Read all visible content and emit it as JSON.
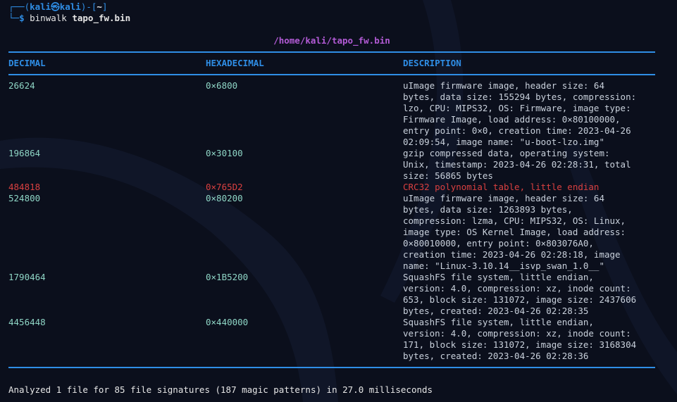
{
  "prompt": {
    "user": "kali",
    "host": "kali",
    "path": "~",
    "command": "binwalk",
    "argument": "tapo_fw.bin"
  },
  "file_title": "/home/kali/tapo_fw.bin",
  "headers": {
    "decimal": "DECIMAL",
    "hexadecimal": "HEXADECIMAL",
    "description": "DESCRIPTION"
  },
  "rows": [
    {
      "decimal": "26624",
      "hex": "0×6800",
      "description": "uImage firmware image, header size: 64\nbytes, data size: 155294 bytes, compression:\nlzo, CPU: MIPS32, OS: Firmware, image type:\nFirmware Image, load address: 0×80100000,\nentry point: 0×0, creation time: 2023-04-26\n02:09:54, image name: \"u-boot-lzo.img\"",
      "warn": false
    },
    {
      "decimal": "196864",
      "hex": "0×30100",
      "description": "gzip compressed data, operating system:\nUnix, timestamp: 2023-04-26 02:28:31, total\nsize: 56865 bytes",
      "warn": false
    },
    {
      "decimal": "484818",
      "hex": "0×765D2",
      "description": "CRC32 polynomial table, little endian",
      "warn": true
    },
    {
      "decimal": "524800",
      "hex": "0×80200",
      "description": "uImage firmware image, header size: 64\nbytes, data size: 1263893 bytes,\ncompression: lzma, CPU: MIPS32, OS: Linux,\nimage type: OS Kernel Image, load address:\n0×80010000, entry point: 0×803076A0,\ncreation time: 2023-04-26 02:28:18, image\nname: \"Linux-3.10.14__isvp_swan_1.0__\"",
      "warn": false
    },
    {
      "decimal": "1790464",
      "hex": "0×1B5200",
      "description": "SquashFS file system, little endian,\nversion: 4.0, compression: xz, inode count:\n653, block size: 131072, image size: 2437606\nbytes, created: 2023-04-26 02:28:35",
      "warn": false
    },
    {
      "decimal": "4456448",
      "hex": "0×440000",
      "description": "SquashFS file system, little endian,\nversion: 4.0, compression: xz, inode count:\n171, block size: 131072, image size: 3168304\nbytes, created: 2023-04-26 02:28:36",
      "warn": false
    }
  ],
  "summary": "Analyzed 1 file for 85 file signatures (187 magic patterns) in 27.0 milliseconds",
  "colors": {
    "background": "#0b0f1c",
    "accent_blue": "#2f8ee6",
    "title_purple": "#b35bd6",
    "value_teal": "#8fd6c6",
    "warning_red": "#d94040"
  }
}
